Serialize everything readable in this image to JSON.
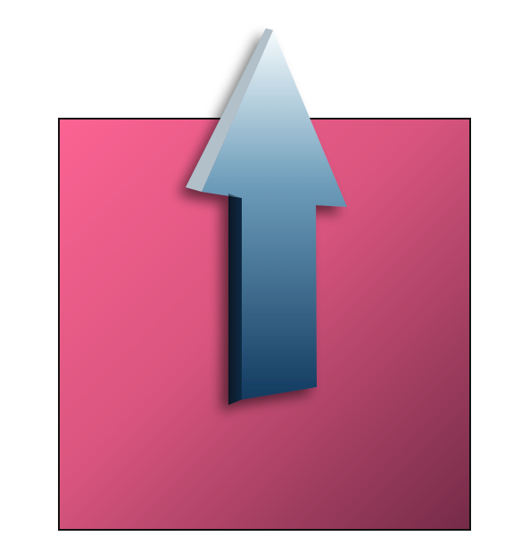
{
  "colors": {
    "background": "#ffffff",
    "square_fill_light": "#fb6393",
    "square_fill_mid": "#d9557f",
    "square_fill_dark": "#742b47",
    "square_border": "#111111",
    "arrow_top": "#f5fbfd",
    "arrow_mid": "#6c9cb9",
    "arrow_bottom": "#123a60",
    "arrow_shadow": "#000000"
  },
  "icons": {
    "arrow": "up-arrow-icon"
  }
}
